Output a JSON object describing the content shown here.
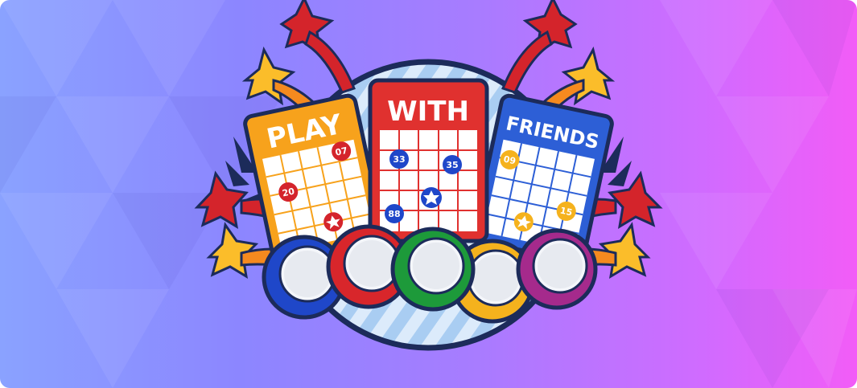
{
  "banner": {
    "cards": [
      {
        "title": "PLAY",
        "color": "#f7a21c"
      },
      {
        "title": "WITH",
        "color": "#e0312f"
      },
      {
        "title": "FRIENDS",
        "color": "#2d5fd6"
      }
    ],
    "numbers": {
      "play": [
        "07",
        "20"
      ],
      "with": [
        "33",
        "35",
        "88"
      ],
      "friends": [
        "09",
        "15"
      ]
    },
    "ball_colors": [
      "#1f47c9",
      "#d8262b",
      "#1d9a3a",
      "#f5b21d",
      "#a52a8c"
    ],
    "colors": {
      "bg_left": "#8aa2ff",
      "bg_right": "#f25cf7",
      "star_red": "#d4242b",
      "star_yellow": "#fbbd2a",
      "outline": "#1c2b5a"
    }
  }
}
